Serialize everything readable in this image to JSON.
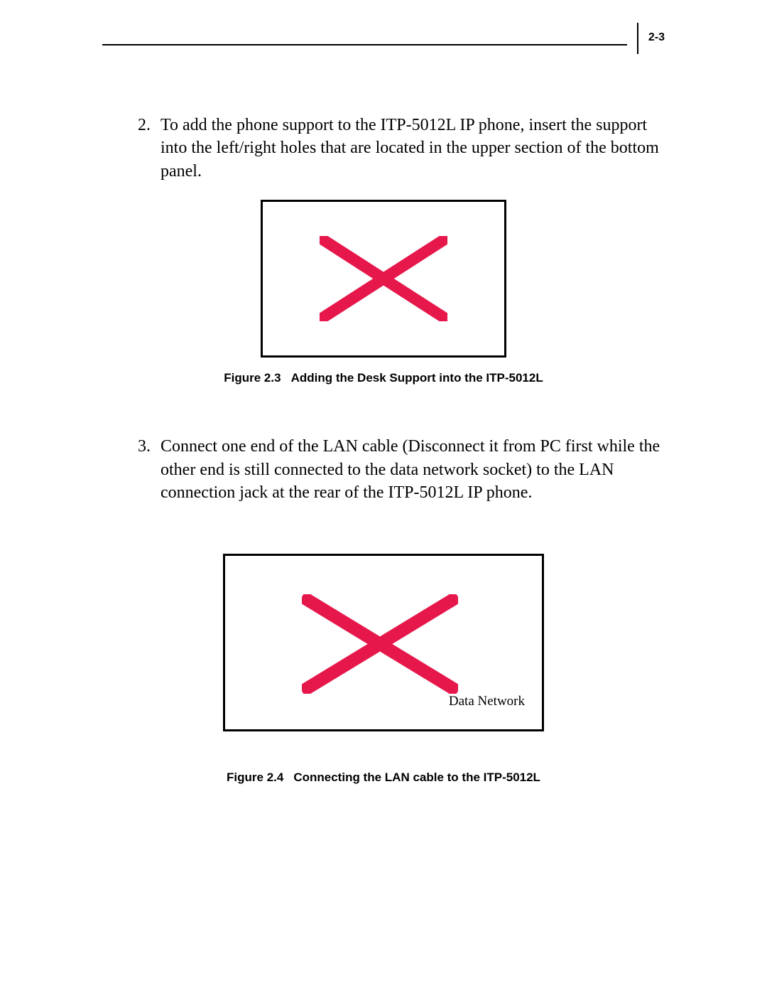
{
  "header": {
    "page_number": "2-3"
  },
  "steps": {
    "item2": {
      "number": "2.",
      "text": "To add the phone support to the ITP-5012L IP phone, insert the support into the left/right holes that are located in the upper section of the bottom panel."
    },
    "item3": {
      "number": "3.",
      "text": "Connect one end of the LAN cable (Disconnect it from PC first while the other end is still connected to the data network socket) to the LAN connection jack at the rear of the ITP-5012L IP phone."
    }
  },
  "figures": {
    "fig23": {
      "caption_prefix": "Figure 2.3",
      "caption_title": "Adding the Desk Support into the ITP-5012L"
    },
    "fig24": {
      "caption_prefix": "Figure 2.4",
      "caption_title": "Connecting the LAN cable to the ITP-5012L",
      "inner_label": "Data Network"
    }
  }
}
